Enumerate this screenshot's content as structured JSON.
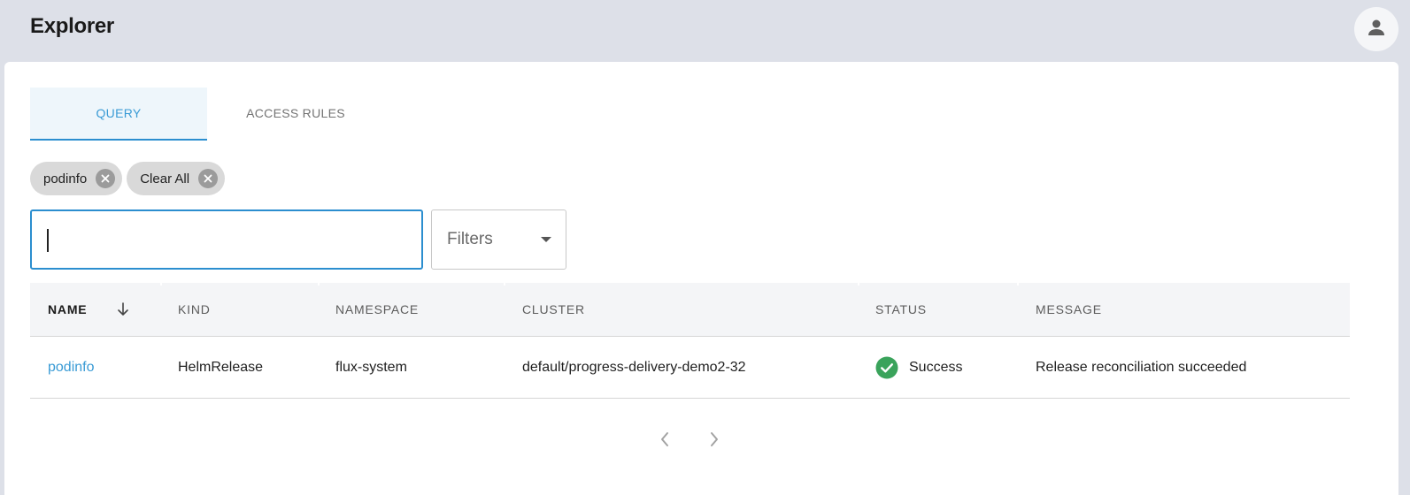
{
  "header": {
    "title": "Explorer",
    "avatar_icon": "account-icon"
  },
  "tabs": [
    {
      "label": "QUERY",
      "active": true
    },
    {
      "label": "ACCESS RULES",
      "active": false
    }
  ],
  "chips": [
    {
      "label": "podinfo"
    },
    {
      "label": "Clear All"
    }
  ],
  "search": {
    "value": "",
    "placeholder": ""
  },
  "filters": {
    "label": "Filters"
  },
  "table": {
    "columns": [
      "NAME",
      "KIND",
      "NAMESPACE",
      "CLUSTER",
      "STATUS",
      "MESSAGE"
    ],
    "sorted_column": "NAME",
    "sort_direction": "descending",
    "rows": [
      {
        "name": "podinfo",
        "kind": "HelmRelease",
        "namespace": "flux-system",
        "cluster": "default/progress-delivery-demo2-32",
        "status": "Success",
        "message": "Release reconciliation succeeded"
      }
    ]
  },
  "colors": {
    "accent": "#2b8ecf",
    "link": "#3a9bd5",
    "success": "#3aa35b",
    "background": "#dde0e8"
  }
}
